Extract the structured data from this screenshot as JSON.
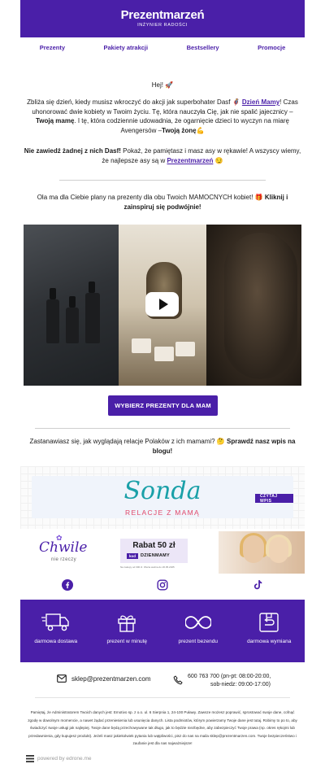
{
  "header": {
    "logo": "Prezentmarzeń",
    "tagline": "INŻYNIER RADOŚCI",
    "background": "#4a1fa8"
  },
  "nav": [
    "Prezenty",
    "Pakiety atrakcji",
    "Bestsellery",
    "Promocje"
  ],
  "greeting": "Hej! 🚀",
  "intro": {
    "t1": "Zbliża się dzień, kiedy musisz wkroczyć do akcji jak superbohater Dasf 🦸 ",
    "link": "Dzień Mamy",
    "t2": "! Czas uhonorować dwie kobiety w Twoim życiu. Tę, która nauczyła Cię, jak nie spalić jajecznicy – ",
    "b1": "Twoją mamę",
    "t3": ". I tę, która codziennie udowadnia, że ogarnięcie dzieci to wyczyn na miarę Avengersów –",
    "b2": "Twoją żonę",
    "t4": "💪"
  },
  "remind": {
    "b": "Nie zawiedź żadnej z nich Dasf!",
    "t1": " Pokaż, że pamiętasz i masz asy w rękawie! A wszyscy wiemy, że najlepsze asy są w ",
    "link": "Prezentmarzeń",
    "t2": " 😏"
  },
  "plans": {
    "t1": "Ola ma dla Ciebie plany na prezenty dla obu Twoich MAMOCNYCH kobiet! 🎁 ",
    "b": "Kliknij i zainspiruj się podwójnie!"
  },
  "cta": "WYBIERZ PREZENTY DLA MAM",
  "blog": {
    "t": "Zastanawiasz się, jak wyglądają relacje Polaków z ich mamami? 🤔 ",
    "b": "Sprawdź nasz wpis na blogu!"
  },
  "banner_sonda": {
    "title": "Sonda",
    "subtitle": "RELACJE Z MAMĄ",
    "button": "CZYTAJ WPIS"
  },
  "banner_chwile": {
    "brand": "Chwile",
    "brand_sub": "nie rzeczy",
    "rabat": "Rabat 50 zł",
    "kod_label": "kod",
    "kod": "DZIENMAMY",
    "note": "Na zakupy od 300 zł. Oferta ważna do 26.05.2025"
  },
  "social": [
    "facebook-icon",
    "instagram-icon",
    "tiktok-icon"
  ],
  "features": [
    {
      "icon": "truck-icon",
      "label": "darmowa dostawa"
    },
    {
      "icon": "gift-icon",
      "label": "prezent w minutę"
    },
    {
      "icon": "infinity-icon",
      "label": "prezent bezendu"
    },
    {
      "icon": "return-box-icon",
      "label": "darmowa wymiana"
    }
  ],
  "contact": {
    "email": "sklep@prezentmarzen.com",
    "phone": "600 763 700",
    "hours1": "(pn-pt: 08:00-20:00,",
    "hours2": "sob-niedz: 09:00-17:00)"
  },
  "privacy": "Pamiętaj, że Administratorem Twoich danych jest: Emotivo sp. z o.o. ul. 6 Sierpnia 1, 24-100 Puławy. Zawsze możesz poprawić, sprostować swoje dane, cofnąć zgodę w dowolnym momencie, a nawet żądać przeniesienia lub usunięcia danych. Lista podmiotów, którym powierzamy Twoje dane jest tutaj. Robimy to po to, aby świadczyć swoje usługi jak najlepiej. Twoje dane będą przechowywane tak długo, jak to będzie niezbędne, aby zabezpieczyć Twoje prawa (np. okres rękojmi lub przedawnienia, gdy kupujesz produkt). Jeżeli masz jakiekolwiek pytania lub wątpliwości, pisz do nas na maila sklep@prezentmarzen.com. Twoje bezpieczeństwo i zaufanie jest dla nas najważniejsze!",
  "footer": "powered by edrone.me",
  "colors": {
    "brand": "#4a1fa8",
    "teal": "#1aa0a8",
    "pink": "#e1486a"
  }
}
